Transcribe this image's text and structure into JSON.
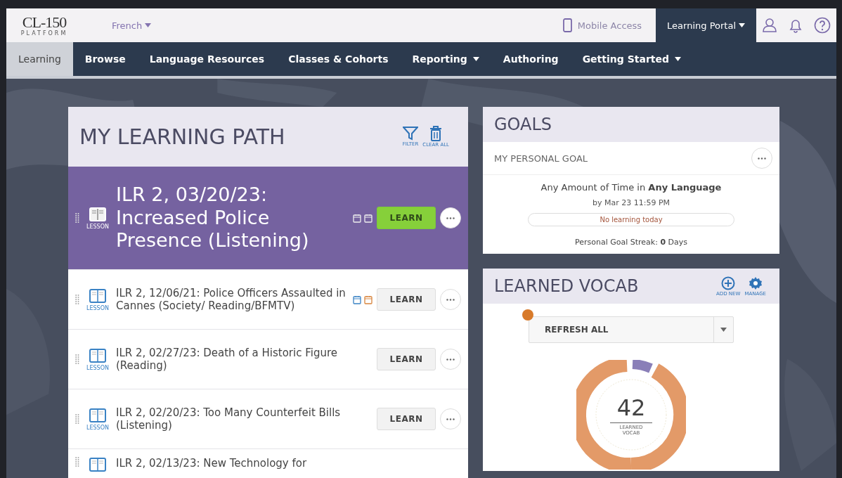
{
  "brand": {
    "name": "CL-150",
    "sub": "PLATFORM"
  },
  "language": {
    "label": "French"
  },
  "top_links": {
    "mobile": "Mobile Access",
    "portal": "Learning Portal"
  },
  "nav": [
    {
      "label": "Learning",
      "selected": true,
      "dropdown": false
    },
    {
      "label": "Browse",
      "selected": false,
      "dropdown": false
    },
    {
      "label": "Language Resources",
      "selected": false,
      "dropdown": false
    },
    {
      "label": "Classes & Cohorts",
      "selected": false,
      "dropdown": false
    },
    {
      "label": "Reporting",
      "selected": false,
      "dropdown": true
    },
    {
      "label": "Authoring",
      "selected": false,
      "dropdown": false
    },
    {
      "label": "Getting Started",
      "selected": false,
      "dropdown": true
    }
  ],
  "learning_path": {
    "title": "MY LEARNING PATH",
    "actions": [
      {
        "kind": "filter",
        "label": "FILTER"
      },
      {
        "kind": "trash",
        "label": "CLEAR ALL"
      }
    ],
    "items": [
      {
        "type_label": "LESSON",
        "title": "ILR 2, 03/20/23: Increased Police Presence (Listening)",
        "selected": true,
        "schedule_icons": true,
        "button": "LEARN"
      },
      {
        "type_label": "LESSON",
        "title": "ILR 2, 12/06/21: Police Officers Assaulted in Cannes (Society/ Reading/BFMTV)",
        "selected": false,
        "schedule_icons": true,
        "button": "LEARN"
      },
      {
        "type_label": "LESSON",
        "title": "ILR 2, 02/27/23: Death of a Historic Figure (Reading)",
        "selected": false,
        "schedule_icons": false,
        "button": "LEARN"
      },
      {
        "type_label": "LESSON",
        "title": "ILR 2, 02/20/23: Too Many Counterfeit Bills (Listening)",
        "selected": false,
        "schedule_icons": false,
        "button": "LEARN"
      },
      {
        "title": "ILR 2, 02/13/23: New Technology for",
        "selected": false,
        "schedule_icons": false
      }
    ]
  },
  "goals": {
    "title": "GOALS",
    "subtitle": "MY PERSONAL GOAL",
    "goal": "Any Amount of Time in **Any Language**",
    "deadline": "by Mar 23 11:59 PM",
    "status": "No learning today",
    "streak": "Personal Goal Streak: **0** Days"
  },
  "vocab": {
    "title": "LEARNED VOCAB",
    "actions": [
      {
        "kind": "add",
        "label": "ADD NEW"
      },
      {
        "kind": "gear",
        "label": "MANAGE"
      }
    ],
    "select": "REFRESH ALL",
    "count": "42",
    "count_label": "LEARNED VOCAB"
  }
}
